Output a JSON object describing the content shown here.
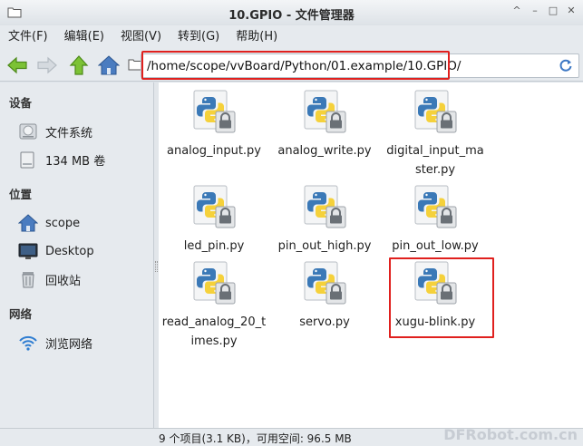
{
  "window": {
    "title": "10.GPIO - 文件管理器"
  },
  "menubar": [
    {
      "label": "文件(F)"
    },
    {
      "label": "编辑(E)"
    },
    {
      "label": "视图(V)"
    },
    {
      "label": "转到(G)"
    },
    {
      "label": "帮助(H)"
    }
  ],
  "location": {
    "path": "/home/scope/vvBoard/Python/01.example/10.GPIO/"
  },
  "sidebar": {
    "sections": [
      {
        "label": "设备",
        "items": [
          {
            "label": "文件系统",
            "icon": "harddisk-icon"
          },
          {
            "label": "134 MB 卷",
            "icon": "drive-icon"
          }
        ]
      },
      {
        "label": "位置",
        "items": [
          {
            "label": "scope",
            "icon": "home-icon"
          },
          {
            "label": "Desktop",
            "icon": "desktop-icon"
          },
          {
            "label": "回收站",
            "icon": "trash-icon"
          }
        ]
      },
      {
        "label": "网络",
        "items": [
          {
            "label": "浏览网络",
            "icon": "wifi-icon"
          }
        ]
      }
    ]
  },
  "files": [
    {
      "name": "analog_input.py"
    },
    {
      "name": "analog_write.py"
    },
    {
      "name": "digital_input_master.py",
      "lines": [
        "digital_input_ma",
        "ster.py"
      ]
    },
    {
      "name": "led_pin.py"
    },
    {
      "name": "pin_out_high.py"
    },
    {
      "name": "pin_out_low.py"
    },
    {
      "name": "read_analog_20_times.py",
      "lines": [
        "read_analog_20_t",
        "imes.py"
      ]
    },
    {
      "name": "servo.py"
    },
    {
      "name": "xugu-blink.py"
    }
  ],
  "status": {
    "text": "9 个项目(3.1 KB)，可用空间: 96.5 MB"
  },
  "watermark": "DFRobot.com.cn",
  "colors": {
    "highlight": "#e0201e",
    "nav_green": "#6ab42a",
    "folder_blue": "#4a7cc0"
  }
}
